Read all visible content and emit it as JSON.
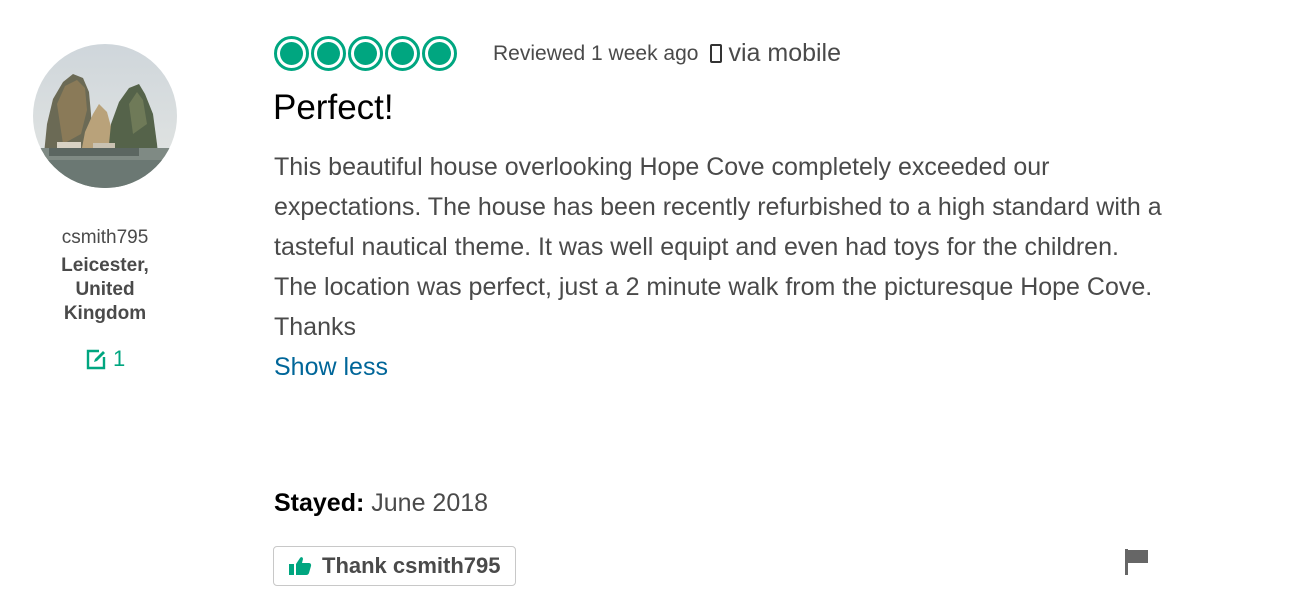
{
  "reviewer": {
    "username": "csmith795",
    "location": "Leicester, United Kingdom",
    "contributions": "1",
    "avatar_icon": "avatar-photo"
  },
  "review": {
    "rating": 5,
    "rating_max": 5,
    "date_text": "Reviewed 1 week ago",
    "via_text": "via mobile",
    "title": "Perfect!",
    "paragraph_1": "This beautiful house overlooking Hope Cove completely exceeded our expectations. The house has been recently refurbished to a high standard with a tasteful nautical theme. It was well equipt and even had toys for the children.",
    "paragraph_2": "The location was perfect, just a 2 minute walk from the picturesque Hope Cove.",
    "paragraph_3": "Thanks",
    "show_less": "Show less",
    "stayed_label": "Stayed:",
    "stayed_value": "June 2018",
    "thank_label": "Thank csmith795"
  },
  "colors": {
    "accent": "#00a680",
    "link": "#006699",
    "text": "#4a4a4a"
  }
}
